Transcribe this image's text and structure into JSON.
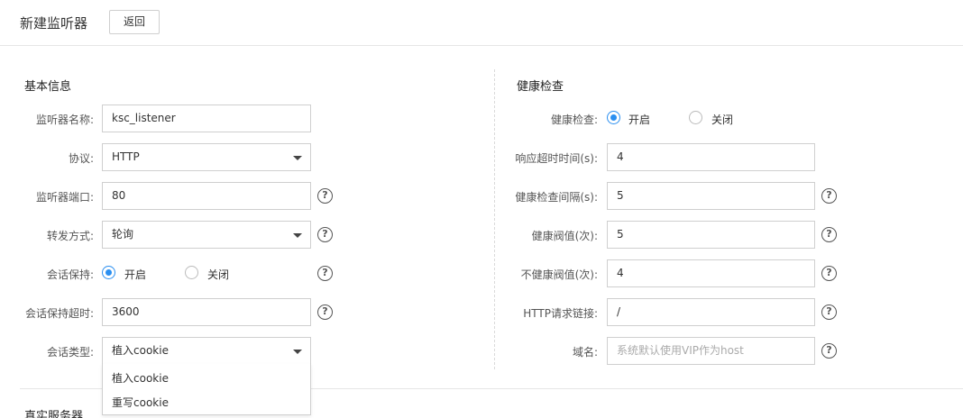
{
  "header": {
    "title": "新建监听器",
    "back_label": "返回"
  },
  "basic": {
    "title": "基本信息",
    "listener_name_label": "监听器名称:",
    "listener_name_value": "ksc_listener",
    "protocol_label": "协议:",
    "protocol_value": "HTTP",
    "port_label": "监听器端口:",
    "port_value": "80",
    "forward_label": "转发方式:",
    "forward_value": "轮询",
    "session_label": "会话保持:",
    "session_on": "开启",
    "session_off": "关闭",
    "session_timeout_label": "会话保持超时:",
    "session_timeout_value": "3600",
    "session_type_label": "会话类型:",
    "session_type_value": "植入cookie",
    "session_type_options": [
      "植入cookie",
      "重写cookie"
    ]
  },
  "health": {
    "title": "健康检查",
    "check_label": "健康检查:",
    "check_on": "开启",
    "check_off": "关闭",
    "timeout_label": "响应超时时间(s):",
    "timeout_value": "4",
    "interval_label": "健康检查间隔(s):",
    "interval_value": "5",
    "healthy_label": "健康阀值(次):",
    "healthy_value": "5",
    "unhealthy_label": "不健康阀值(次):",
    "unhealthy_value": "4",
    "http_link_label": "HTTP请求链接:",
    "http_link_value": "/",
    "domain_label": "域名:",
    "domain_placeholder": "系统默认使用VIP作为host"
  },
  "next_section": {
    "title": "真实服务器"
  },
  "help_glyph": "?",
  "colors": {
    "accent": "#2b8ff0",
    "border": "#cfcfcf"
  }
}
